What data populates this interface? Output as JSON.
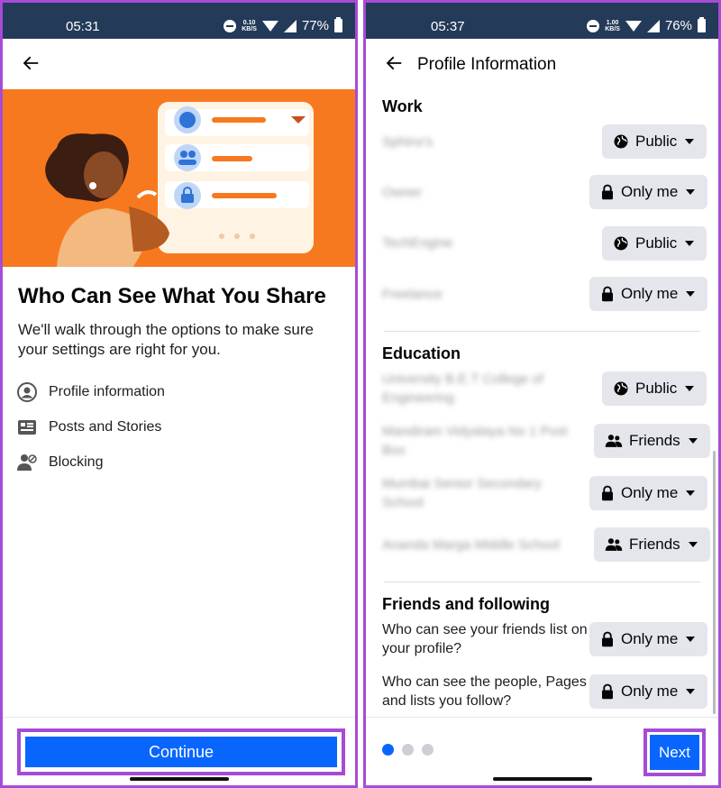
{
  "left": {
    "status": {
      "time": "05:31",
      "speed_top": "0.10",
      "speed_unit": "KB/S",
      "battery": "77%"
    },
    "headline": "Who Can See What You Share",
    "subtitle": "We'll walk through the options to make sure your settings are right for you.",
    "options": [
      {
        "label": "Profile information",
        "icon": "user-circle-icon"
      },
      {
        "label": "Posts and Stories",
        "icon": "newsfeed-icon"
      },
      {
        "label": "Blocking",
        "icon": "block-user-icon"
      }
    ],
    "continue_label": "Continue"
  },
  "right": {
    "status": {
      "time": "05:37",
      "speed_top": "1.00",
      "speed_unit": "KB/S",
      "battery": "76%"
    },
    "title": "Profile Information",
    "sections": {
      "work": "Work",
      "education": "Education",
      "friends": "Friends and following"
    },
    "work_rows": [
      {
        "blurred_text": "Sphinx's",
        "privacy": "Public"
      },
      {
        "blurred_text": "Owner",
        "privacy": "Only me"
      },
      {
        "blurred_text": "TechEngine",
        "privacy": "Public"
      },
      {
        "blurred_text": "Freelance",
        "privacy": "Only me"
      }
    ],
    "education_rows": [
      {
        "blurred_text": "University B.E.T College of Engineering",
        "privacy": "Public"
      },
      {
        "blurred_text": "Mandiram Vidyalaya No 1 Post Box",
        "privacy": "Friends"
      },
      {
        "blurred_text": "Mumbai Senior Secondary School",
        "privacy": "Only me"
      },
      {
        "blurred_text": "Ananda Marga Middle School",
        "privacy": "Friends"
      }
    ],
    "friends_rows": [
      {
        "question": "Who can see your friends list on your profile?",
        "privacy": "Only me"
      },
      {
        "question": "Who can see the people, Pages and lists you follow?",
        "privacy": "Only me"
      }
    ],
    "next_label": "Next",
    "pagination": {
      "current": 1,
      "total": 3
    }
  },
  "colors": {
    "accent": "#0866ff",
    "highlight": "#a64bd6",
    "hero": "#f7791f",
    "statusbar": "#233a58"
  }
}
